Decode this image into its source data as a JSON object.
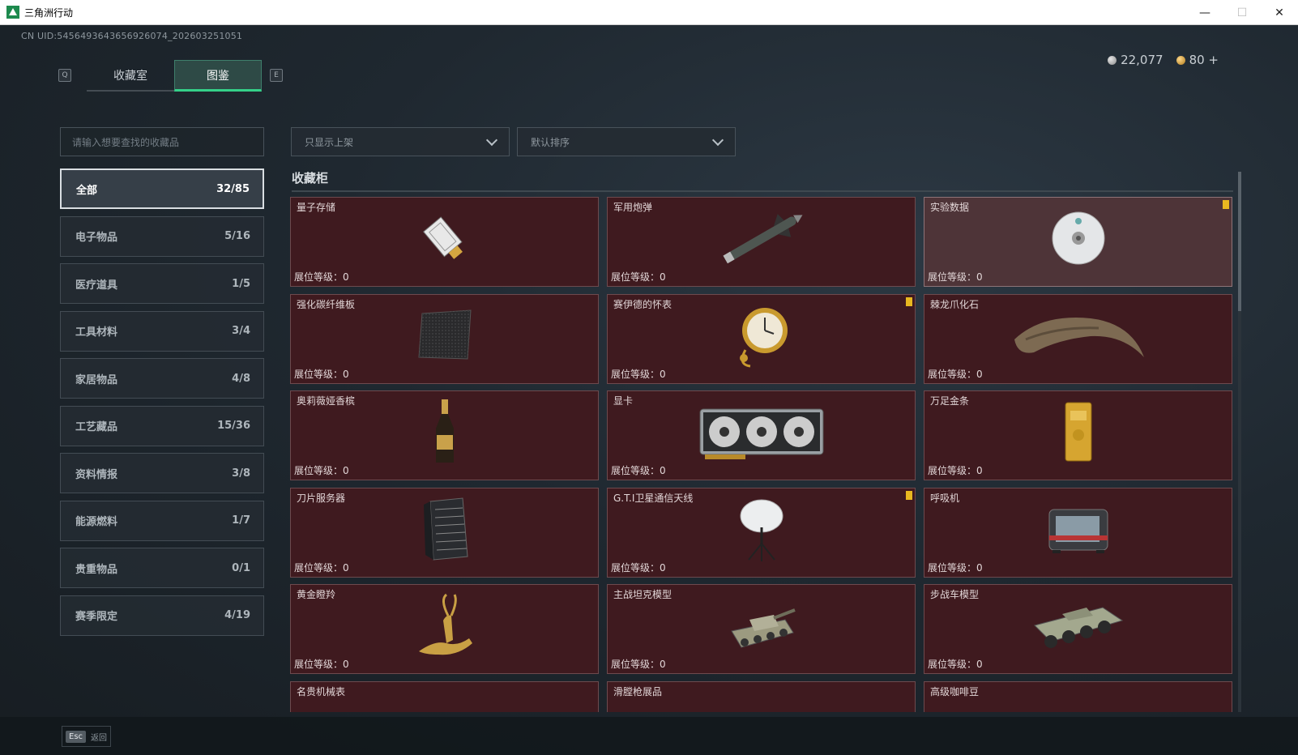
{
  "window": {
    "title": "三角洲行动"
  },
  "header": {
    "uid": "CN UID:5456493643656926074_202603251051",
    "key_left": "Q",
    "key_right": "E",
    "tabs": [
      {
        "label": "收藏室",
        "active": false
      },
      {
        "label": "图鉴",
        "active": true
      }
    ],
    "currency_silver": "22,077",
    "currency_gold": "80 +"
  },
  "sidebar": {
    "search_placeholder": "请输入想要查找的收藏品",
    "categories": [
      {
        "label": "全部",
        "count": "32/85",
        "active": true
      },
      {
        "label": "电子物品",
        "count": "5/16"
      },
      {
        "label": "医疗道具",
        "count": "1/5"
      },
      {
        "label": "工具材料",
        "count": "3/4"
      },
      {
        "label": "家居物品",
        "count": "4/8"
      },
      {
        "label": "工艺藏品",
        "count": "15/36"
      },
      {
        "label": "资料情报",
        "count": "3/8"
      },
      {
        "label": "能源燃料",
        "count": "1/7"
      },
      {
        "label": "贵重物品",
        "count": "0/1"
      },
      {
        "label": "赛季限定",
        "count": "4/19"
      }
    ]
  },
  "filters": {
    "shelf": "只显示上架",
    "sort": "默认排序"
  },
  "section": {
    "title": "收藏柜"
  },
  "level_label": "展位等级：0",
  "items": [
    {
      "name": "量子存储",
      "icon": "usb-drive-icon"
    },
    {
      "name": "军用炮弹",
      "icon": "missile-icon"
    },
    {
      "name": "实验数据",
      "icon": "disc-icon",
      "selected": true,
      "badge": true
    },
    {
      "name": "强化碳纤维板",
      "icon": "carbon-plate-icon"
    },
    {
      "name": "赛伊德的怀表",
      "icon": "pocket-watch-icon",
      "badge": true
    },
    {
      "name": "棘龙爪化石",
      "icon": "claw-fossil-icon"
    },
    {
      "name": "奥莉薇娅香槟",
      "icon": "champagne-icon"
    },
    {
      "name": "显卡",
      "icon": "graphics-card-icon"
    },
    {
      "name": "万足金条",
      "icon": "gold-bar-icon"
    },
    {
      "name": "刀片服务器",
      "icon": "server-icon"
    },
    {
      "name": "G.T.I卫星通信天线",
      "icon": "satellite-dish-icon",
      "badge": true
    },
    {
      "name": "呼吸机",
      "icon": "ventilator-icon"
    },
    {
      "name": "黄金瞪羚",
      "icon": "gold-gazelle-icon"
    },
    {
      "name": "主战坦克模型",
      "icon": "tank-icon"
    },
    {
      "name": "步战车模型",
      "icon": "ifv-icon"
    },
    {
      "name": "名贵机械表",
      "icon": "watch-icon"
    },
    {
      "name": "滑膛枪展品",
      "icon": "musket-icon"
    },
    {
      "name": "高级咖啡豆",
      "icon": "coffee-icon"
    }
  ],
  "footer": {
    "esc_key": "Esc",
    "back_label": "返回"
  }
}
